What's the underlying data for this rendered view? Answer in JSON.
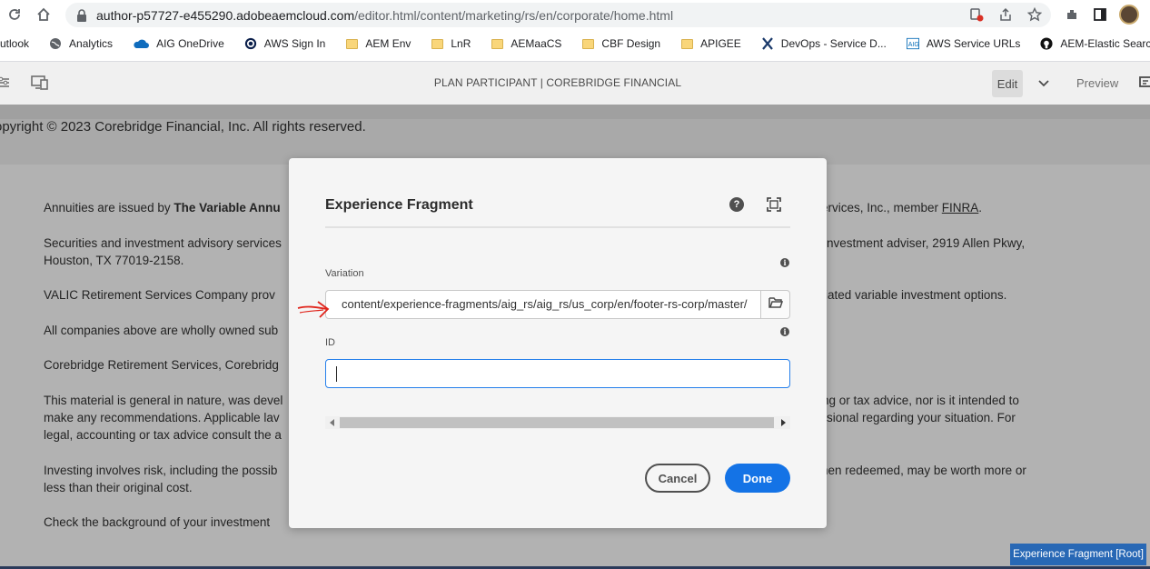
{
  "browser": {
    "url_host": "author-p57727-e455290.adobeaemcloud.com",
    "url_path": "/editor.html/content/marketing/rs/en/corporate/home.html"
  },
  "bookmarks": [
    {
      "label": "utlook",
      "icon": "outlook-icon"
    },
    {
      "label": "Analytics",
      "icon": "globe-icon"
    },
    {
      "label": "AIG OneDrive",
      "icon": "cloud-icon"
    },
    {
      "label": "AWS Sign In",
      "icon": "aws-circle-icon"
    },
    {
      "label": "AEM Env",
      "icon": "folder-icon"
    },
    {
      "label": "LnR",
      "icon": "folder-icon"
    },
    {
      "label": "AEMaaCS",
      "icon": "folder-icon"
    },
    {
      "label": "CBF Design",
      "icon": "folder-icon"
    },
    {
      "label": "APIGEE",
      "icon": "folder-icon"
    },
    {
      "label": "DevOps - Service D...",
      "icon": "devops-icon"
    },
    {
      "label": "AWS Service URLs",
      "icon": "aig-icon"
    },
    {
      "label": "AEM-Elastic Search",
      "icon": "github-icon"
    }
  ],
  "editor": {
    "page_title": "PLAN PARTICIPANT | COREBRIDGE FINANCIAL",
    "edit_label": "Edit",
    "preview_label": "Preview"
  },
  "page": {
    "copyright": "opyright © 2023 Corebridge Financial, Inc.  All rights reserved.",
    "para1_a": "Annuities are issued by ",
    "para1_b": "The Variable Annu",
    "para1_c": "ervices, Inc., member ",
    "para1_link": "FINRA",
    "para1_d": ".",
    "para2_a": "Securities and investment advisory services",
    "para2_b": "nvestment adviser, 2919 Allen Pkwy,",
    "para2_c": "Houston, TX 77019-2158.",
    "para3_a": "VALIC Retirement Services Company prov",
    "para3_b": "iliated variable investment options.",
    "para4_a": "All companies above are wholly owned sub",
    "para5_a": "Corebridge Retirement Services, Corebridg",
    "para6_a": "This material is general in nature, was devel",
    "para6_b": "ing or tax advice, nor is it intended to",
    "para6_c": "make any recommendations. Applicable lav",
    "para6_d": "sional regarding your situation. For",
    "para6_e": "legal, accounting or tax advice consult the a",
    "para7_a": "Investing involves risk, including the possib",
    "para7_b": "hen redeemed, may be worth more or",
    "para7_c": "less than their original cost.",
    "para8_a": "Check the background of your investment"
  },
  "component_tag": "Experience Fragment [Root]",
  "dialog": {
    "title": "Experience Fragment",
    "help_glyph": "?",
    "variation_label": "Variation",
    "variation_value": "content/experience-fragments/aig_rs/aig_rs/us_corp/en/footer-rs-corp/master/",
    "id_label": "ID",
    "id_value": "",
    "info_glyph": "i",
    "cancel_label": "Cancel",
    "done_label": "Done"
  },
  "colors": {
    "accent": "#1473e6",
    "annotation": "#e0241b",
    "tag_bg": "#2868b5"
  }
}
